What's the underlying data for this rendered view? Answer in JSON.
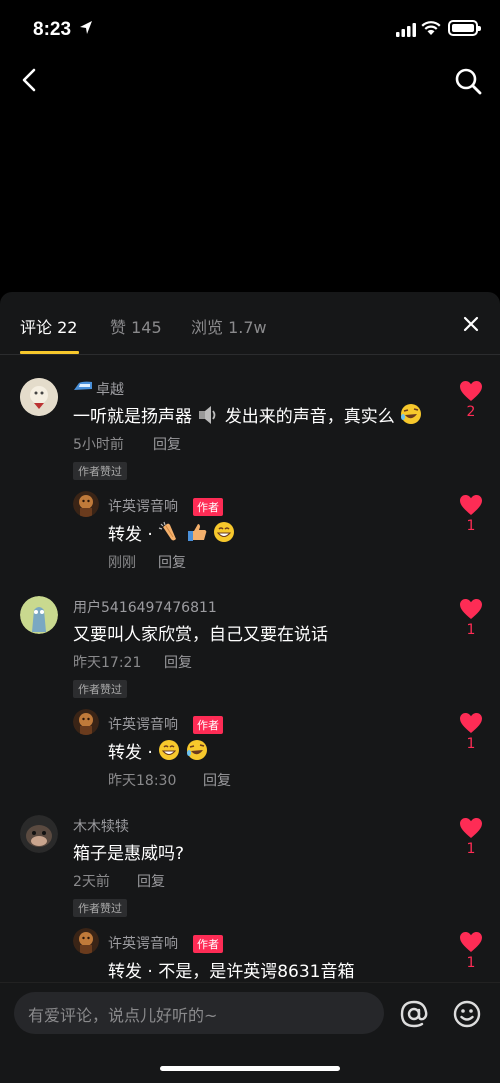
{
  "status_bar": {
    "time": "8:23"
  },
  "tabs": [
    {
      "label": "评论 22",
      "active": true
    },
    {
      "label": "赞 145",
      "active": false
    },
    {
      "label": "浏览 1.7w",
      "active": false
    }
  ],
  "comments": [
    {
      "username": "卓越",
      "text": "一听就是扬声器",
      "text_after_emoji": "发出来的声音，真实么",
      "time": "5小时前",
      "reply": "回复",
      "liked_label": "作者赞过",
      "likes": "2",
      "reply_item": {
        "username": "许英谔音响",
        "badge": "作者",
        "text": "转发 ·",
        "time": "刚刚",
        "reply": "回复",
        "likes": "1"
      }
    },
    {
      "username": "用户5416497476811",
      "text": "又要叫人家欣赏，自己又要在说话",
      "time": "昨天17:21",
      "reply": "回复",
      "liked_label": "作者赞过",
      "likes": "1",
      "reply_item": {
        "username": "许英谔音响",
        "badge": "作者",
        "text": "转发 ·",
        "time": "昨天18:30",
        "reply": "回复",
        "likes": "1"
      }
    },
    {
      "username": "木木犊犊",
      "text": "箱子是惠威吗?",
      "time": "2天前",
      "reply": "回复",
      "liked_label": "作者赞过",
      "likes": "1",
      "reply_item": {
        "username": "许英谔音响",
        "badge": "作者",
        "text": "转发 · 不是，是许英谔8631音箱",
        "likes": "1"
      }
    }
  ],
  "input": {
    "placeholder": "有爱评论，说点儿好听的~"
  },
  "icons": {
    "back": "chevron-left-icon",
    "search": "search-icon",
    "close": "close-icon",
    "heart": "heart-icon",
    "at": "at-icon",
    "emoji": "emoji-icon"
  },
  "colors": {
    "accent": "#f7c82c",
    "heart": "#fe2c55",
    "panel": "#161718"
  }
}
